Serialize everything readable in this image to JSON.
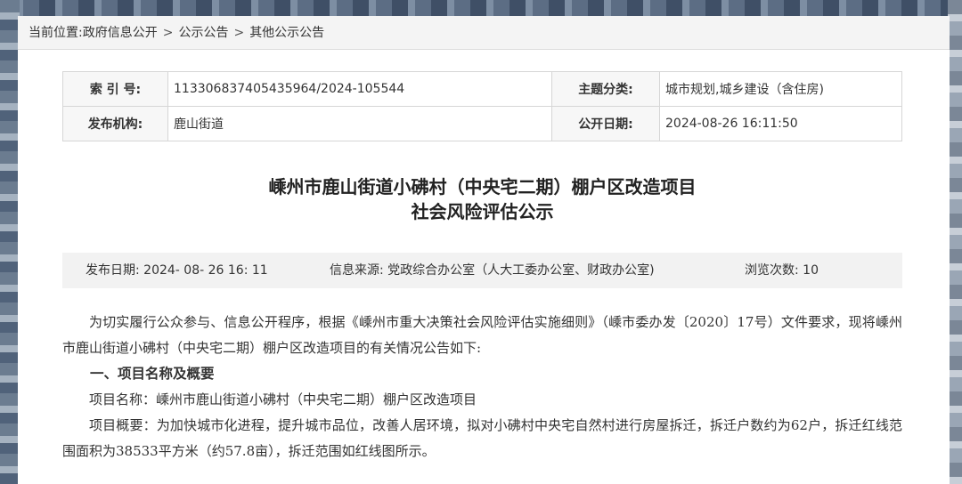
{
  "breadcrumb": {
    "prefix": "当前位置:",
    "items": [
      "政府信息公开",
      "公示公告",
      "其他公示公告"
    ],
    "separator": ">"
  },
  "meta": {
    "index_label": "索 引 号:",
    "index_value": "113306837405435964/2024-105544",
    "topic_label": "主题分类:",
    "topic_value": "城市规划,城乡建设（含住房)",
    "publisher_label": "发布机构:",
    "publisher_value": "鹿山街道",
    "open_date_label": "公开日期:",
    "open_date_value": "2024-08-26 16:11:50"
  },
  "article": {
    "title_line1": "嵊州市鹿山街道小砩村（中央宅二期）棚户区改造项目",
    "title_line2": "社会风险评估公示",
    "publish_date": "发布日期:  2024- 08- 26 16: 11",
    "source": "信息来源:   党政综合办公室（人大工委办公室、财政办公室)",
    "views": "浏览次数:   10",
    "para1": "为切实履行公众参与、信息公开程序，根据《嵊州市重大决策社会风险评估实施细则》（嵊市委办发〔2020〕17号）文件要求，现将嵊州市鹿山街道小砩村（中央宅二期）棚户区改造项目的有关情况公告如下:",
    "section1": "一、项目名称及概要",
    "para2": "项目名称：嵊州市鹿山街道小砩村（中央宅二期）棚户区改造项目",
    "para3": "项目概要：为加快城市化进程，提升城市品位，改善人居环境，拟对小砩村中央宅自然村进行房屋拆迁，拆迁户数约为62户，拆迁红线范围面积为38533平方米（约57.8亩），拆迁范围如红线图所示。"
  }
}
